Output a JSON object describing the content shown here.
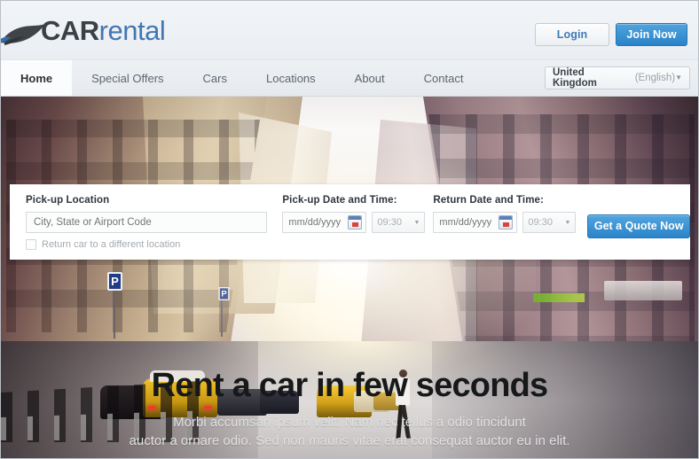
{
  "header": {
    "logo": {
      "icon": "car-silhouette-icon",
      "text_primary": "CAR",
      "text_secondary": "rental"
    },
    "login_label": "Login",
    "join_label": "Join Now"
  },
  "nav": {
    "items": [
      {
        "label": "Home",
        "active": true
      },
      {
        "label": "Special Offers",
        "active": false
      },
      {
        "label": "Cars",
        "active": false
      },
      {
        "label": "Locations",
        "active": false
      },
      {
        "label": "About",
        "active": false
      },
      {
        "label": "Contact",
        "active": false
      }
    ],
    "country_select": {
      "country": "United Kingdom",
      "language": "(English)",
      "arrow": "▼"
    }
  },
  "booking": {
    "pickup_location": {
      "label": "Pick-up Location",
      "value": "",
      "placeholder": "City, State or Airport Code"
    },
    "different_location": {
      "label": "Return car to a different  location",
      "checked": false
    },
    "pickup_date": {
      "label": "Pick-up Date and Time:",
      "date_value": "",
      "date_placeholder": "mm/dd/yyyy",
      "time_value": "09:30",
      "calendar_icon": "calendar-icon",
      "arrow": "▼"
    },
    "return_date": {
      "label": "Return Date and Time:",
      "date_value": "",
      "date_placeholder": "mm/dd/yyyy",
      "time_value": "09:30",
      "calendar_icon": "calendar-icon",
      "arrow": "▼"
    },
    "quote_button": "Get a Quote Now"
  },
  "hero": {
    "title": "Rent a car in few seconds",
    "subtitle_line1": "Morbi accumsan ipsum velit. Nam nec tellus a odio tincidunt",
    "subtitle_line2": "auctor a ornare odio. Sed non  mauris vitae erat consequat auctor eu in elit."
  },
  "colors": {
    "accent_blue": "#2b84c9",
    "logo_blue": "#4277b0",
    "header_bg": "#eef1f4",
    "text_dark": "#2f353b",
    "muted": "#a4aaaf"
  }
}
